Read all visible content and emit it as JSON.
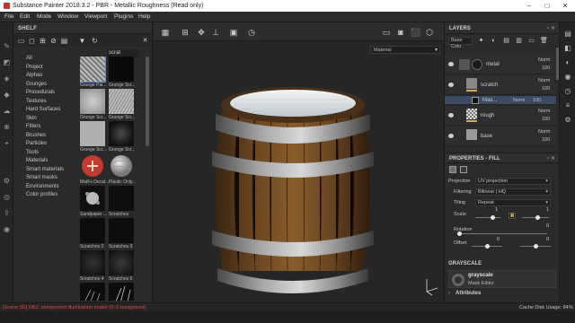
{
  "window": {
    "title": "Substance Painter 2018.3.2 - PBR - Metallic Roughness (Read only)",
    "minimize": "–",
    "maximize": "□",
    "close": "✕"
  },
  "menu": [
    "File",
    "Edit",
    "Mode",
    "Window",
    "Viewport",
    "Plugins",
    "Help"
  ],
  "shelf": {
    "title": "SHELF",
    "search_value": "scrat",
    "categories": [
      "All",
      "Project",
      "Alphas",
      "Grunges",
      "Procedurals",
      "Textures",
      "Hard Surfaces",
      "Skin",
      "Filters",
      "Brushes",
      "Particles",
      "Tools",
      "Materials",
      "Smart materials",
      "Smart masks",
      "Environments",
      "Color profiles"
    ],
    "thumbnails": [
      "Grunge Pai...",
      "Grunge Scr...",
      "Grunge Scr...",
      "Grunge Scr...",
      "Grunge Scr...",
      "Grunge Scr...",
      "MatFx Decal...",
      "Plastic Only...",
      "Sandpaper ...",
      "Scratches",
      "Scratches 2",
      "Scratches 3",
      "Scratches 4",
      "Scratches 5"
    ]
  },
  "viewport": {
    "channel_select": "Material"
  },
  "layers": {
    "title": "LAYERS",
    "channel": "Base Colo",
    "items": [
      {
        "name": "metal",
        "blend": "Norm",
        "opacity": "100"
      },
      {
        "name": "scratch",
        "blend": "Norm",
        "opacity": "100"
      },
      {
        "name": "Mas...",
        "blend": "Norm",
        "opacity": "100"
      },
      {
        "name": "rough",
        "blend": "Norm",
        "opacity": "100"
      },
      {
        "name": "base",
        "blend": "Norm",
        "opacity": "100"
      }
    ]
  },
  "properties": {
    "title": "PROPERTIES - FILL",
    "projection_label": "Projection",
    "projection_value": "UV projection",
    "filtering_label": "Filtering",
    "filtering_value": "Bilinear | HQ",
    "tiling_label": "Tiling",
    "tiling_value": "Repeat",
    "scale_label": "Scale",
    "scale_value": "1",
    "scale_value2": "1",
    "rotation_label": "Rotation",
    "rotation_value": "0",
    "offset_label": "Offset",
    "offset_value": "0",
    "offset_value2": "0",
    "grayscale_header": "GRAYSCALE",
    "grayscale_name": "grayscale",
    "grayscale_sub": "Mask Editor",
    "attributes": "Attributes"
  },
  "status": {
    "error": "[Scene 3D] OBJ: unexpected illumination model (0~2 recognized)",
    "cache_label": "Cache Disk Usage:",
    "cache_value": "84%"
  },
  "colors": {
    "accent": "#d9a94a",
    "error": "#e04a3c"
  }
}
